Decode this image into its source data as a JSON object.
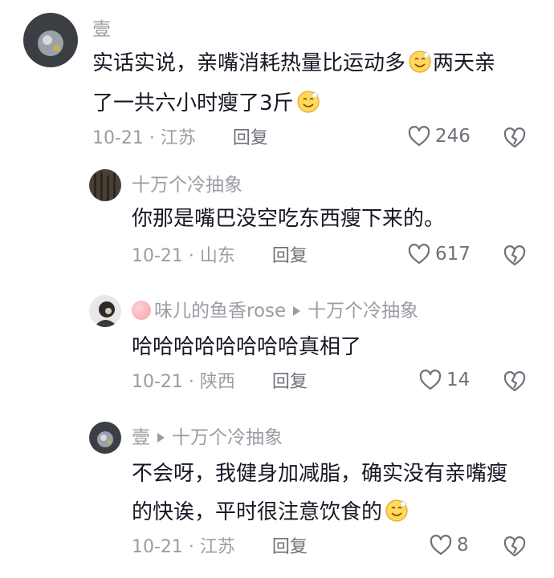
{
  "comments": [
    {
      "author": "壹",
      "text_line1": "实话实说，亲嘴消耗热量比运动多",
      "text_line2_a": "两天亲",
      "text_line2": "了一共六小时瘦了3斤",
      "date": "10-21 · 江苏",
      "reply_label": "回复",
      "likes": "246"
    },
    {
      "author": "十万个冷抽象",
      "text_line1": "你那是嘴巴没空吃东西瘦下来的。",
      "date": "10-21 · 山东",
      "reply_label": "回复",
      "likes": "617"
    },
    {
      "author": "味儿的鱼香rose",
      "reply_to": "十万个冷抽象",
      "text_line1": "哈哈哈哈哈哈哈哈真相了",
      "date": "10-21 · 陕西",
      "reply_label": "回复",
      "likes": "14"
    },
    {
      "author": "壹",
      "reply_to": "十万个冷抽象",
      "text_line1": "不会呀，我健身加减脂，确实没有亲嘴瘦",
      "text_line2": "的快诶，平时很注意饮食的",
      "date": "10-21 · 江苏",
      "reply_label": "回复",
      "likes": "8"
    }
  ],
  "icons": {
    "like": "heart-outline-icon",
    "dislike": "broken-heart-icon",
    "emoji": "smile-emoji-icon"
  },
  "colors": {
    "text": "#161823",
    "meta": "#9a9ca3",
    "action": "#6f717a"
  }
}
